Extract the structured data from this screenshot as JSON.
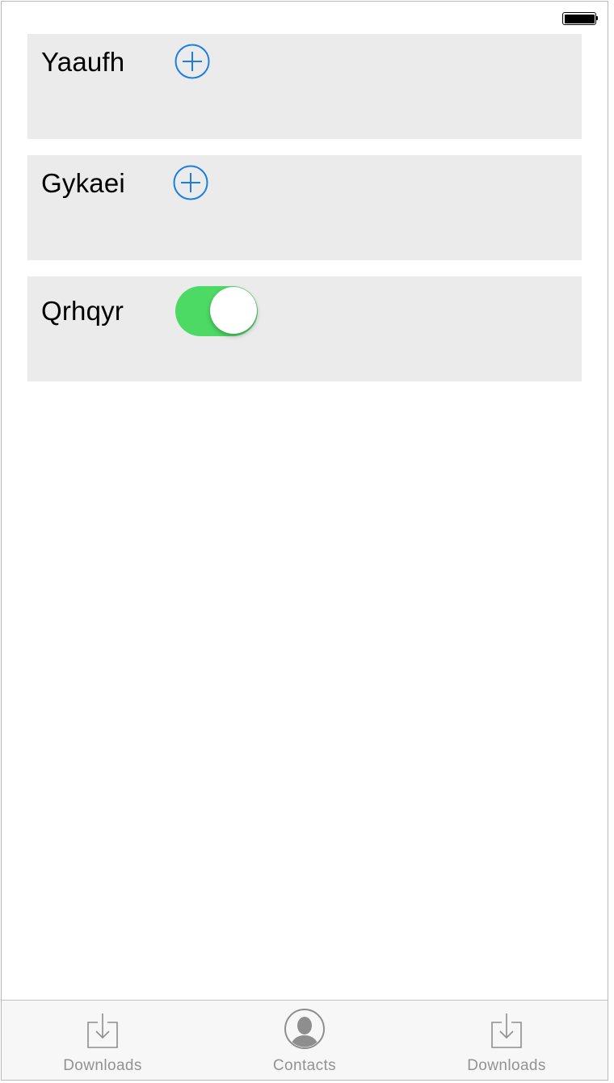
{
  "status_bar": {
    "battery_icon": "battery-full-icon"
  },
  "rows": [
    {
      "label": "Yaaufh",
      "control": "add-button",
      "icon": "plus-circle-icon"
    },
    {
      "label": "Gykaei",
      "control": "add-button",
      "icon": "plus-circle-icon"
    },
    {
      "label": "Qrhqyr",
      "control": "toggle",
      "toggle_on": true
    }
  ],
  "tab_bar": {
    "tabs": [
      {
        "label": "Downloads",
        "icon": "download-icon"
      },
      {
        "label": "Contacts",
        "icon": "contact-icon"
      },
      {
        "label": "Downloads",
        "icon": "download-icon"
      }
    ]
  },
  "colors": {
    "accent": "#1a7ee4",
    "toggle_on": "#4cd964",
    "row_background": "#ebebeb",
    "tab_label": "#929292"
  }
}
